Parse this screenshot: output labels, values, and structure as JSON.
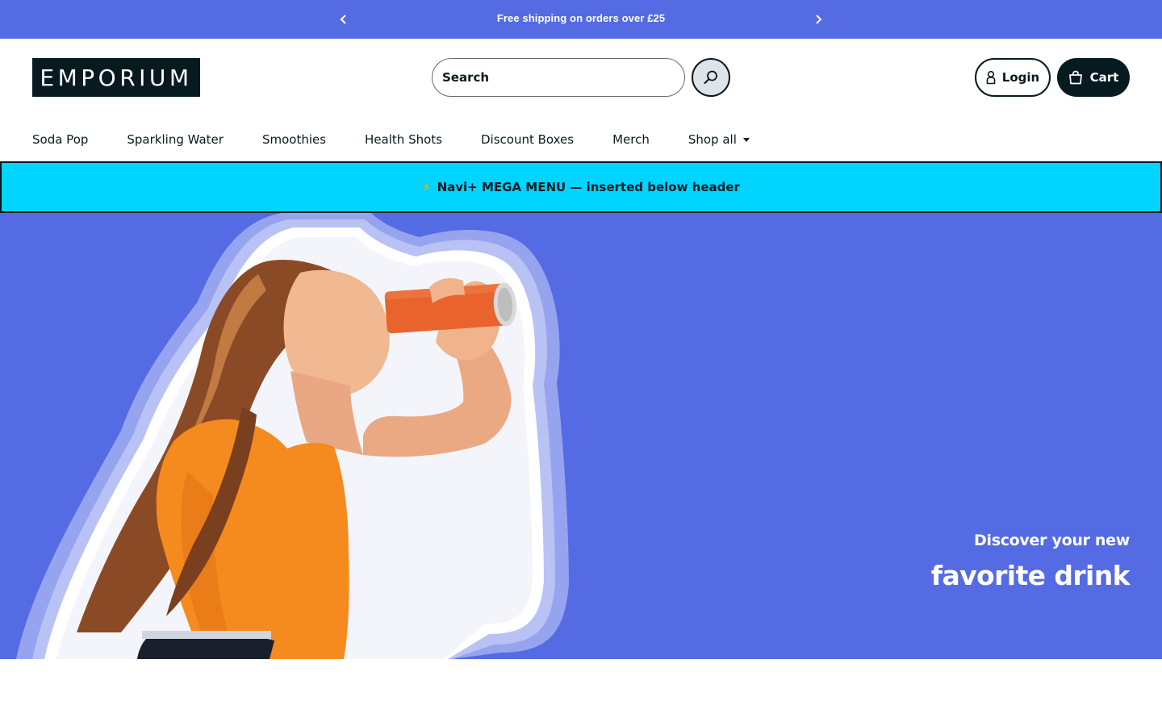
{
  "announcement": {
    "text": "Free shipping on orders over £25",
    "prev_icon": "chevron-left-icon",
    "next_icon": "chevron-right-icon"
  },
  "header": {
    "logo_text": "EMPORIUM",
    "search": {
      "placeholder": "Search",
      "button_icon": "search-icon"
    },
    "login_label": "Login",
    "cart_label": "Cart"
  },
  "nav": {
    "items": [
      {
        "label": "Soda Pop"
      },
      {
        "label": "Sparkling Water"
      },
      {
        "label": "Smoothies"
      },
      {
        "label": "Health Shots"
      },
      {
        "label": "Discount Boxes"
      },
      {
        "label": "Merch"
      },
      {
        "label": "Shop all"
      }
    ]
  },
  "mega_menu": {
    "icon": "⚡",
    "text": "Navi+ MEGA MENU — inserted below header"
  },
  "hero": {
    "line1": "Discover your new",
    "line2": "favorite drink"
  },
  "colors": {
    "accent": "#546be3",
    "dark": "#061a1f",
    "mega_bg": "#00d4ff",
    "can": "#e8632e",
    "top": "#f58a1f"
  }
}
